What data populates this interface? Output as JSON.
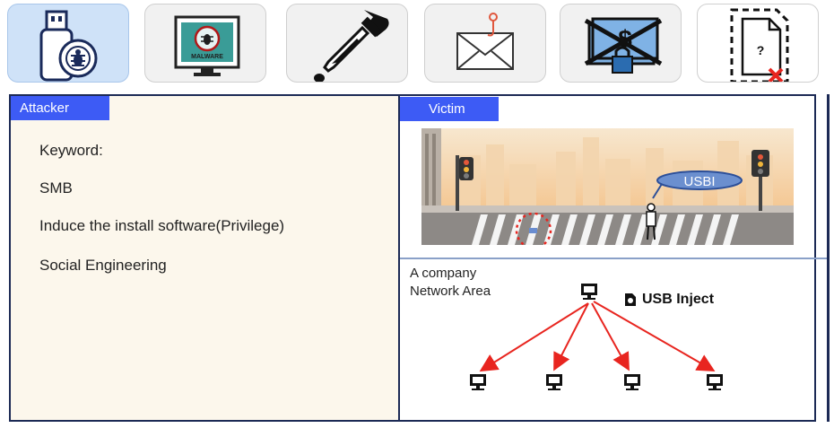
{
  "toolbar": {
    "tiles": [
      {
        "icon": "usb-malware-icon",
        "selected": true
      },
      {
        "icon": "malware-monitor-icon",
        "caption": "MALWARE"
      },
      {
        "icon": "dropper-icon"
      },
      {
        "icon": "phishing-mail-icon"
      },
      {
        "icon": "ransom-locked-money-icon"
      },
      {
        "icon": "unknown-file-icon",
        "caption": "?"
      }
    ]
  },
  "attacker": {
    "tag": "Attacker",
    "keywords": [
      "Keyword:",
      "SMB",
      "Induce the install software(Privilege)",
      "Social Engineering"
    ]
  },
  "victim": {
    "tag": "Victim",
    "scene": {
      "bubble": "USBI"
    },
    "network": {
      "label_line1": "A company",
      "label_line2": "Network Area",
      "usb_inject": "USB Inject"
    }
  },
  "colors": {
    "tag_blue": "#3d5bf5",
    "frame": "#1c2a55",
    "arrow": "#e8251f",
    "panel_bg": "#fcf7ec"
  }
}
